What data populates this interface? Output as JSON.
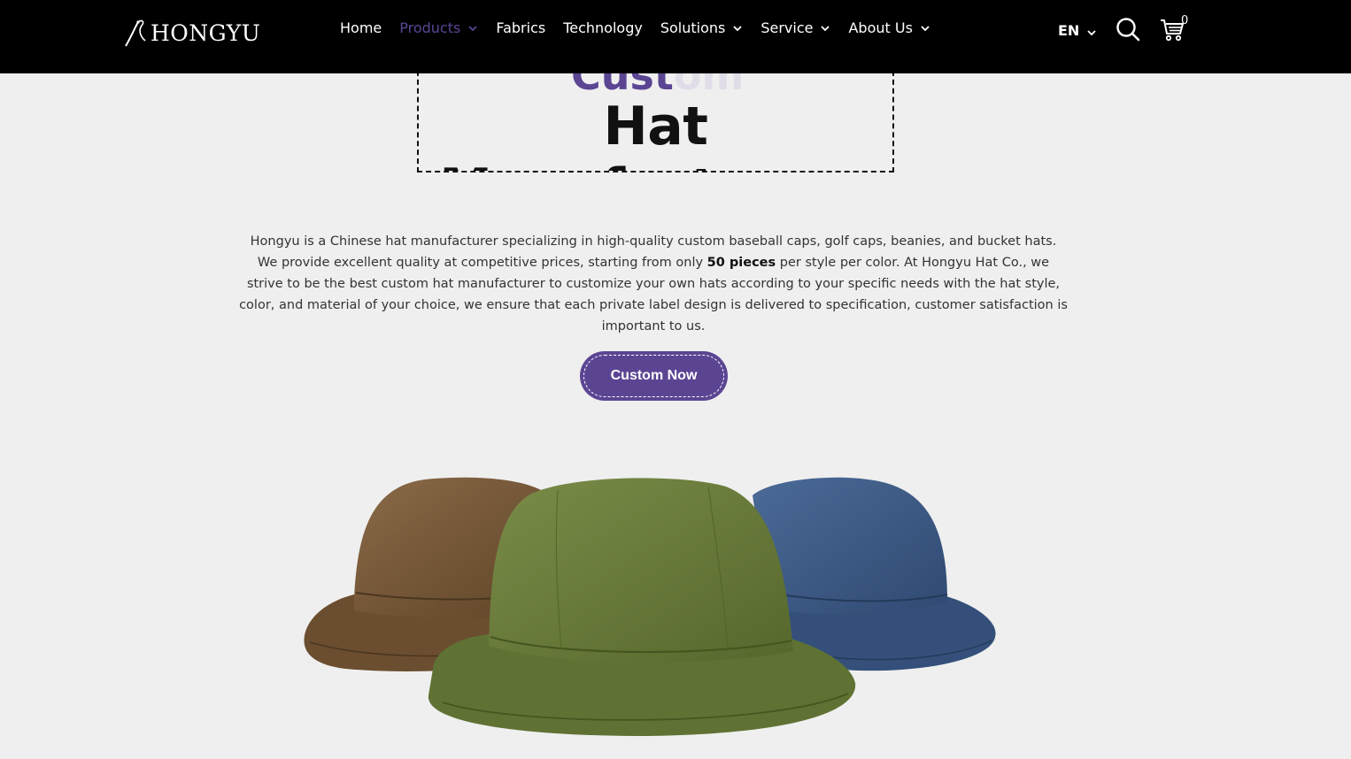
{
  "brand": {
    "name": "HONGYU"
  },
  "nav": {
    "items": [
      {
        "label": "Home",
        "dropdown": false,
        "active": false
      },
      {
        "label": "Products",
        "dropdown": true,
        "active": true
      },
      {
        "label": "Fabrics",
        "dropdown": false,
        "active": false
      },
      {
        "label": "Technology",
        "dropdown": false,
        "active": false
      },
      {
        "label": "Solutions",
        "dropdown": true,
        "active": false
      },
      {
        "label": "Service",
        "dropdown": true,
        "active": false
      },
      {
        "label": "About Us",
        "dropdown": true,
        "active": false
      }
    ],
    "language": "EN",
    "cart_count": "0"
  },
  "hero": {
    "title_peek": "Custom",
    "title": "Hat Manufacturers",
    "intro_before": "Hongyu is a Chinese hat manufacturer specializing in high-quality custom baseball caps, golf caps, beanies, and bucket hats. We provide excellent quality at competitive prices, starting from only ",
    "intro_bold": "50 pieces",
    "intro_after": " per style per color. At Hongyu Hat Co., we strive to be the best custom hat manufacturer to customize your own hats according to your specific needs with the hat style, color, and material of your choice, we ensure that each private label design is delivered to specification, customer satisfaction is important to us.",
    "cta_label": "Custom Now",
    "image_content": [
      "brown-bucket-hat",
      "green-bucket-hat",
      "blue-bucket-hat"
    ]
  },
  "colors": {
    "accent": "#5b4593",
    "nav_bg": "#000000",
    "page_bg": "#efefef",
    "hat_brown": "#7a5a3a",
    "hat_green": "#6b7d3c",
    "hat_blue": "#3e5a84"
  }
}
